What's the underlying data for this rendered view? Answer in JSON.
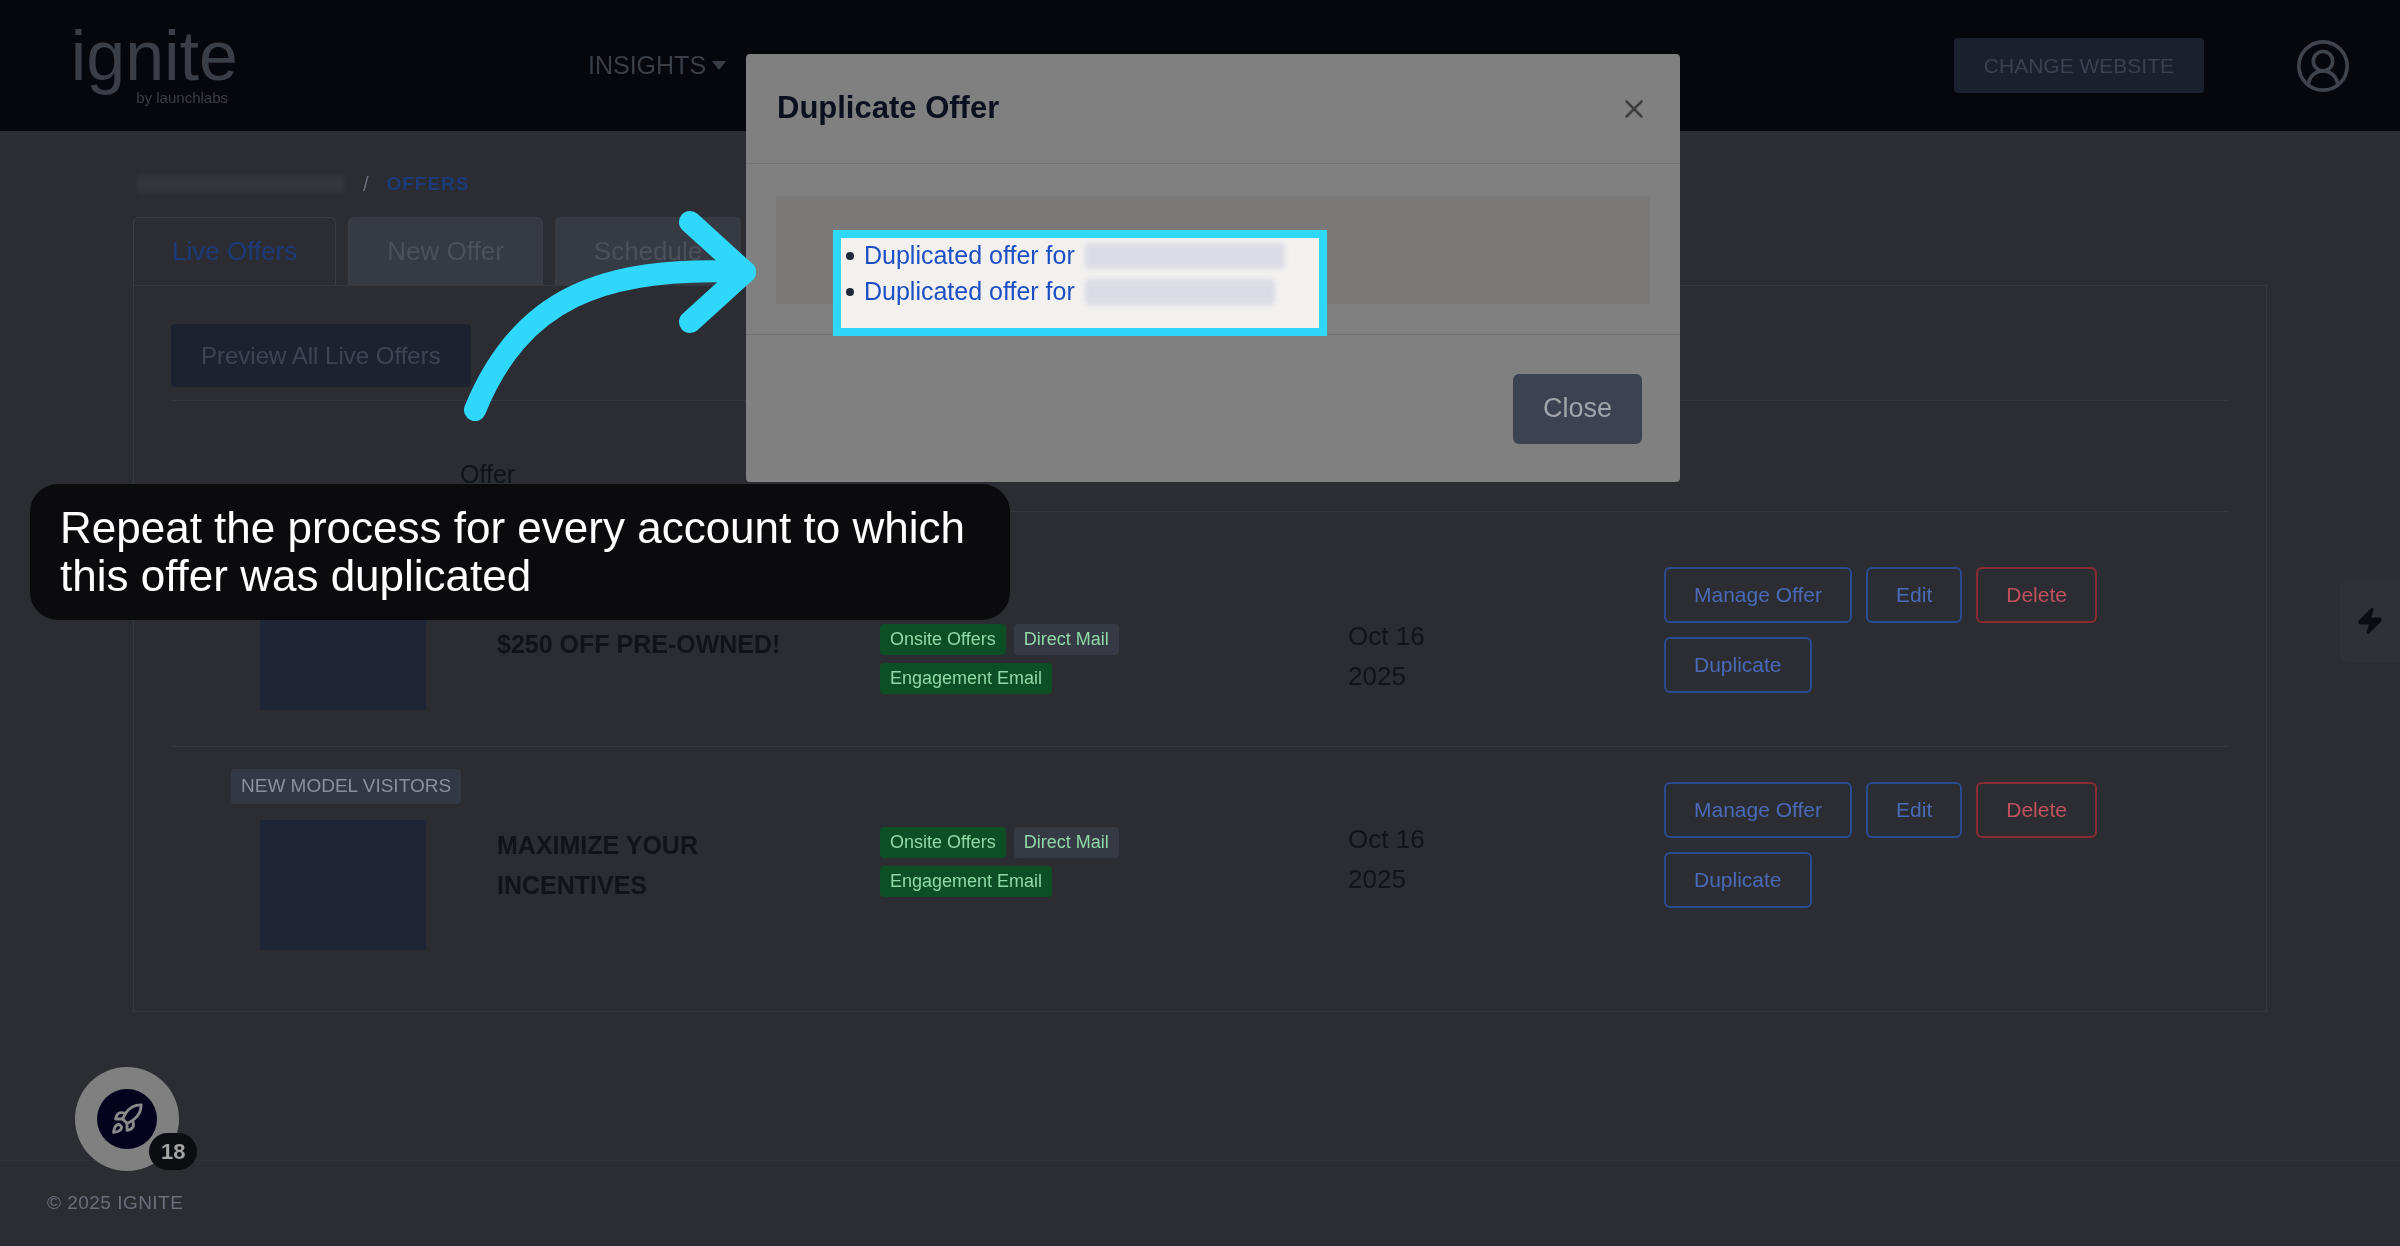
{
  "header": {
    "logo": "ignite",
    "logo_tagline": "by launchlabs",
    "nav": [
      {
        "label": "INSIGHTS"
      }
    ],
    "change_website": "CHANGE WEBSITE"
  },
  "breadcrumb": {
    "separator": "/",
    "current": "OFFERS"
  },
  "tabs": [
    {
      "label": "Live Offers",
      "selected": true
    },
    {
      "label": "New Offer",
      "selected": false
    },
    {
      "label": "Schedule",
      "selected": false
    }
  ],
  "preview_button": "Preview All Live Offers",
  "table": {
    "columns": [
      "Offer"
    ],
    "rows": [
      {
        "title": "$250 OFF PRE-OWNED!",
        "tags": [
          {
            "label": "Onsite Offers",
            "color": "#0d4f24"
          },
          {
            "label": "Direct Mail",
            "color": "#363a45"
          },
          {
            "label": "Engagement Email",
            "color": "#0d4f24"
          }
        ],
        "date": "Oct 16 2025",
        "actions": [
          {
            "label": "Manage Offer",
            "kind": "primary"
          },
          {
            "label": "Edit",
            "kind": "primary"
          },
          {
            "label": "Delete",
            "kind": "danger"
          },
          {
            "label": "Duplicate",
            "kind": "primary"
          }
        ]
      },
      {
        "badge": "NEW MODEL VISITORS",
        "title": "MAXIMIZE YOUR INCENTIVES",
        "tags": [
          {
            "label": "Onsite Offers",
            "color": "#0d4f24"
          },
          {
            "label": "Direct Mail",
            "color": "#363a45"
          },
          {
            "label": "Engagement Email",
            "color": "#0d4f24"
          }
        ],
        "date": "Oct 16 2025",
        "actions": [
          {
            "label": "Manage Offer",
            "kind": "primary"
          },
          {
            "label": "Edit",
            "kind": "primary"
          },
          {
            "label": "Delete",
            "kind": "danger"
          },
          {
            "label": "Duplicate",
            "kind": "primary"
          }
        ]
      }
    ]
  },
  "modal": {
    "title": "Duplicate Offer",
    "items": [
      {
        "text": "Duplicated offer for"
      },
      {
        "text": "Duplicated offer for"
      }
    ],
    "close_button": "Close"
  },
  "callout": {
    "text": "Repeat the process for every account to which this offer was duplicated"
  },
  "widget": {
    "badge": "18"
  },
  "footer": "© 2025 IGNITE"
}
